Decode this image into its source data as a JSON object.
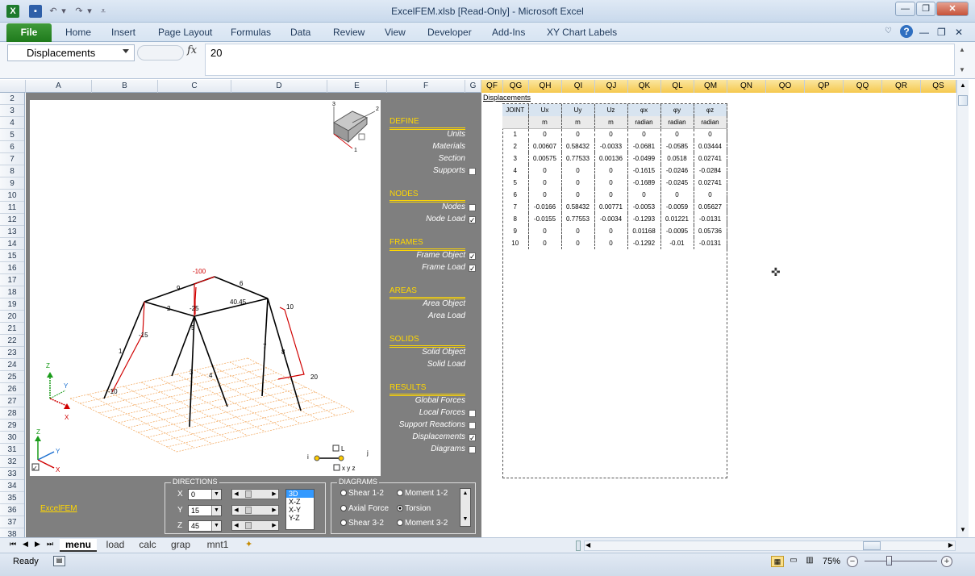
{
  "window": {
    "title": "ExcelFEM.xlsb  [Read-Only]  -  Microsoft Excel"
  },
  "ribbon": {
    "file": "File",
    "tabs": [
      "Home",
      "Insert",
      "Page Layout",
      "Formulas",
      "Data",
      "Review",
      "View",
      "Developer",
      "Add-Ins",
      "XY Chart Labels"
    ]
  },
  "formula_bar": {
    "name_box": "Displacements",
    "fx": "fx",
    "value": "20"
  },
  "columns": {
    "left": [
      "A",
      "B",
      "C",
      "D",
      "E",
      "F",
      "G"
    ],
    "right": [
      "QF",
      "QG",
      "QH",
      "QI",
      "QJ",
      "QK",
      "QL",
      "QM",
      "QN",
      "QO",
      "QP",
      "QQ",
      "QR",
      "QS"
    ]
  },
  "rows": [
    "2",
    "3",
    "4",
    "5",
    "6",
    "7",
    "8",
    "9",
    "10",
    "11",
    "12",
    "13",
    "14",
    "15",
    "16",
    "17",
    "18",
    "19",
    "20",
    "21",
    "22",
    "23",
    "24",
    "25",
    "26",
    "27",
    "28",
    "29",
    "30",
    "31",
    "32",
    "33",
    "34",
    "35",
    "36",
    "37",
    "38"
  ],
  "menu": {
    "define": {
      "header": "DEFINE",
      "items": [
        {
          "label": "Units"
        },
        {
          "label": "Materials"
        },
        {
          "label": "Section"
        },
        {
          "label": "Supports",
          "checked": false
        }
      ]
    },
    "nodes": {
      "header": "NODES",
      "items": [
        {
          "label": "Nodes",
          "checked": false
        },
        {
          "label": "Node Load",
          "checked": true
        }
      ]
    },
    "frames": {
      "header": "FRAMES",
      "items": [
        {
          "label": "Frame Object",
          "checked": true
        },
        {
          "label": "Frame Load",
          "checked": true
        }
      ]
    },
    "areas": {
      "header": "AREAS",
      "items": [
        {
          "label": "Area Object"
        },
        {
          "label": "Area Load"
        }
      ]
    },
    "solids": {
      "header": "SOLIDS",
      "items": [
        {
          "label": "Solid Object"
        },
        {
          "label": "Solid Load"
        }
      ]
    },
    "results": {
      "header": "RESULTS",
      "items": [
        {
          "label": "Global Forces"
        },
        {
          "label": "Local Forces",
          "checked": false
        },
        {
          "label": "Support Reactions",
          "checked": false
        },
        {
          "label": "Displacements",
          "checked": true
        },
        {
          "label": "Diagrams",
          "checked": false
        }
      ]
    }
  },
  "model": {
    "labels": {
      "load_top": "-100",
      "load_mid": "-25",
      "load_right_top": "10",
      "load_right_bottom": "20",
      "load_left": "-15",
      "load_left_bottom": "-10",
      "mid_value": "40.45",
      "n1": "1",
      "n2": "2",
      "n3": "3",
      "n4": "4",
      "n5": "5",
      "n6": "6",
      "n7": "7",
      "n8": "8",
      "n9": "9"
    },
    "axis_small": {
      "z": "Z",
      "y": "Y",
      "x": "X"
    },
    "axis_corner": {
      "z": "Z",
      "y": "Y",
      "x": "X"
    },
    "section_axes": {
      "a1": "1",
      "a2": "2",
      "a3": "3"
    },
    "element_legend": {
      "i": "i",
      "j": "j",
      "l": "L",
      "xyz": "x y z"
    }
  },
  "excelfem_link": "ExcelFEM",
  "directions": {
    "title": "DIRECTIONS",
    "x_label": "X",
    "x_value": "0",
    "y_label": "Y",
    "y_value": "15",
    "z_label": "Z",
    "z_value": "45",
    "views": [
      "3D",
      "X-Z",
      "X-Y",
      "Y-Z"
    ]
  },
  "diagrams": {
    "title": "DIAGRAMS",
    "options": [
      {
        "label": "Shear 1-2",
        "selected": false
      },
      {
        "label": "Moment 1-2",
        "selected": false
      },
      {
        "label": "Axial Force",
        "selected": false
      },
      {
        "label": "Torsion",
        "selected": true
      },
      {
        "label": "Shear 3-2",
        "selected": false
      },
      {
        "label": "Moment 3-2",
        "selected": false
      }
    ]
  },
  "displacements": {
    "title": "Displacements",
    "headers": [
      "JOINT",
      "Ux",
      "Uy",
      "Uz",
      "φx",
      "φy",
      "φz"
    ],
    "units": [
      "",
      "m",
      "m",
      "m",
      "radian",
      "radian",
      "radian"
    ],
    "rows": [
      [
        "1",
        "0",
        "0",
        "0",
        "0",
        "0",
        "0"
      ],
      [
        "2",
        "0.00607",
        "0.58432",
        "-0.0033",
        "-0.0681",
        "-0.0585",
        "0.03444"
      ],
      [
        "3",
        "0.00575",
        "0.77533",
        "0.00136",
        "-0.0499",
        "0.0518",
        "0.02741"
      ],
      [
        "4",
        "0",
        "0",
        "0",
        "-0.1615",
        "-0.0246",
        "-0.0284"
      ],
      [
        "5",
        "0",
        "0",
        "0",
        "-0.1689",
        "-0.0245",
        "0.02741"
      ],
      [
        "6",
        "0",
        "0",
        "0",
        "0",
        "0",
        "0"
      ],
      [
        "7",
        "-0.0166",
        "0.58432",
        "0.00771",
        "-0.0053",
        "-0.0059",
        "0.05627"
      ],
      [
        "8",
        "-0.0155",
        "0.77553",
        "-0.0034",
        "-0.1293",
        "0.01221",
        "-0.0131"
      ],
      [
        "9",
        "0",
        "0",
        "0",
        "0.01168",
        "-0.0095",
        "0.05736"
      ],
      [
        "10",
        "0",
        "0",
        "0",
        "-0.1292",
        "-0.01",
        "-0.0131"
      ]
    ]
  },
  "sheets": [
    "menu",
    "load",
    "calc",
    "grap",
    "mnt1"
  ],
  "status": {
    "ready": "Ready",
    "zoom": "75%"
  }
}
